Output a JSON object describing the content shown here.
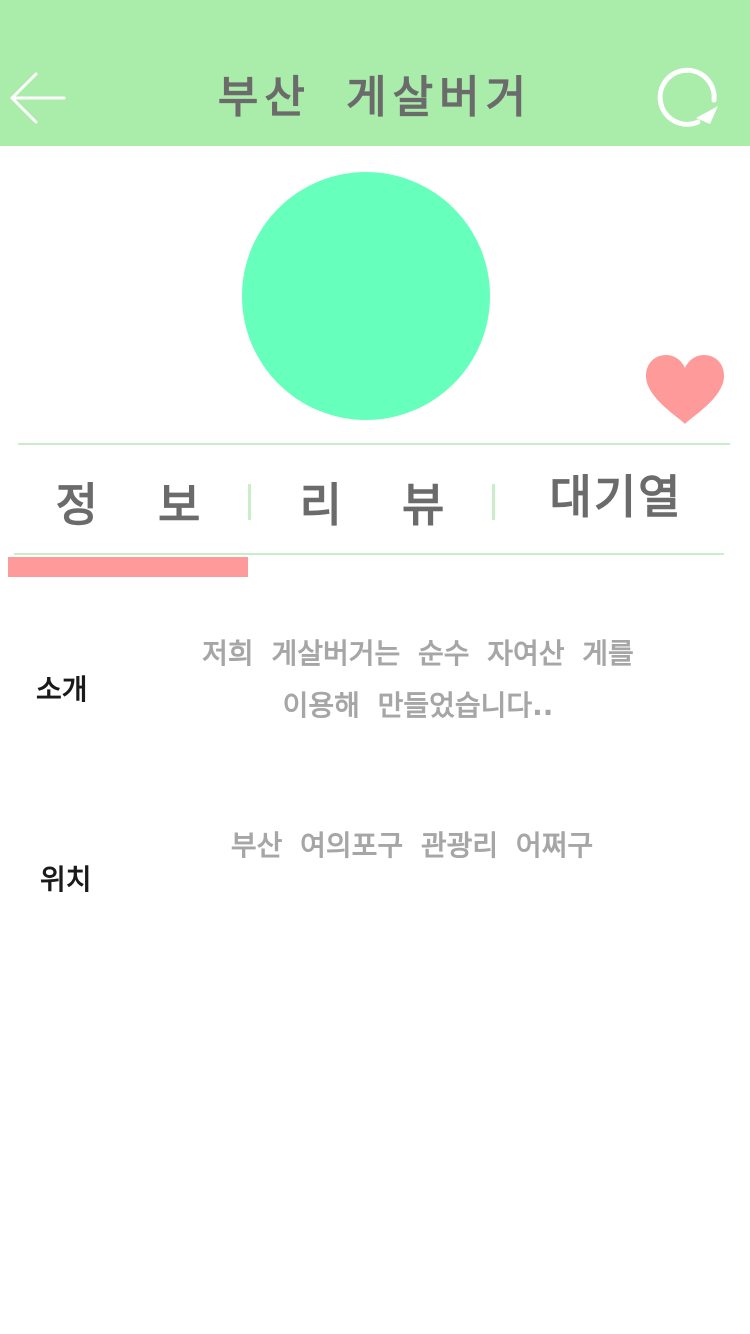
{
  "header": {
    "title": "부산 게살버거",
    "back_icon": "arrow-left-icon",
    "refresh_icon": "refresh-icon",
    "background_color": "#aaeca9"
  },
  "store": {
    "image_color": "#66ffbb",
    "favorite_icon": "heart-icon",
    "favorite_color": "#ff9a9a"
  },
  "tabs": [
    {
      "label": "정 보",
      "selected": true
    },
    {
      "label": "리 뷰",
      "selected": false
    },
    {
      "label": "대기열",
      "selected": false
    }
  ],
  "tab_indicator_color": "#ff9a9a",
  "info": {
    "intro_label": "소개",
    "intro_line1": "저희 게살버거는 순수 자여산 게를",
    "intro_line2": "이용해 만들었습니다..",
    "location_label": "위치",
    "location_text": "부산 여의포구 관광리 어쩌구"
  }
}
